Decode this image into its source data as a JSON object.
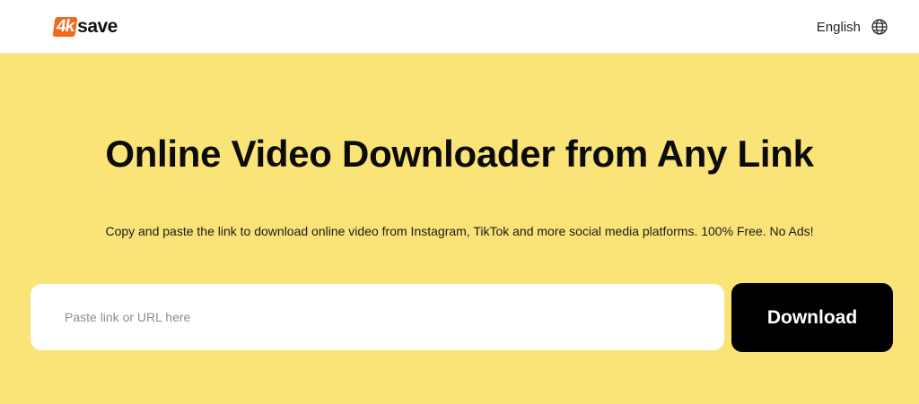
{
  "header": {
    "logo_badge": "4k",
    "logo_text": "save",
    "language_label": "English",
    "language_icon": "globe-icon"
  },
  "hero": {
    "title": "Online Video Downloader from Any Link",
    "subtitle": "Copy and paste the link to download online video from Instagram, TikTok and more social media platforms. 100% Free. No Ads!"
  },
  "search": {
    "placeholder": "Paste link or URL here",
    "value": "",
    "button_label": "Download"
  },
  "colors": {
    "hero_background": "#fae478",
    "logo_accent": "#f26a1b",
    "button_background": "#000000"
  }
}
